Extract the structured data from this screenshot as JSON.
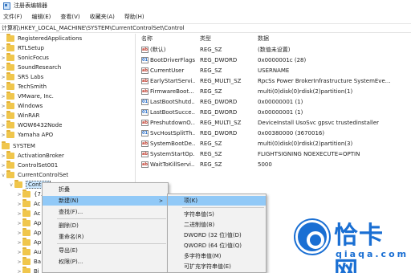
{
  "window": {
    "title": "注册表编辑器"
  },
  "menu": [
    "文件(F)",
    "编辑(E)",
    "查看(V)",
    "收藏夹(A)",
    "帮助(H)"
  ],
  "address": "计算机\\HKEY_LOCAL_MACHINE\\SYSTEM\\CurrentControlSet\\Control",
  "tree": [
    {
      "label": "RegisteredApplications"
    },
    {
      "label": "RTLSetup"
    },
    {
      "label": "SonicFocus"
    },
    {
      "label": "SoundResearch"
    },
    {
      "label": "SRS Labs"
    },
    {
      "label": "TechSmith"
    },
    {
      "label": "VMware, Inc."
    },
    {
      "label": "Windows"
    },
    {
      "label": "WinRAR"
    },
    {
      "label": "WOW6432Node"
    },
    {
      "label": "Yamaha APO"
    },
    {
      "label": "SYSTEM"
    },
    {
      "label": "ActivationBroker"
    },
    {
      "label": "ControlSet001"
    },
    {
      "label": "CurrentControlSet"
    },
    {
      "label": "Control"
    },
    {
      "label": "{7..."
    },
    {
      "label": "Ac"
    },
    {
      "label": "Ac"
    },
    {
      "label": "Ap"
    },
    {
      "label": "Ap"
    },
    {
      "label": "Ap"
    },
    {
      "label": "Au"
    },
    {
      "label": "Ba"
    },
    {
      "label": "Bi"
    }
  ],
  "columns": {
    "name": "名称",
    "type": "类型",
    "data": "数据"
  },
  "values": [
    {
      "name": "(默认)",
      "type": "REG_SZ",
      "data": "(数值未设置)"
    },
    {
      "name": "BootDriverFlags",
      "type": "REG_DWORD",
      "data": "0x0000001c (28)"
    },
    {
      "name": "CurrentUser",
      "type": "REG_SZ",
      "data": "USERNAME"
    },
    {
      "name": "EarlyStartServi...",
      "type": "REG_MULTI_SZ",
      "data": "RpcSs Power BrokerInfrastructure SystemEve..."
    },
    {
      "name": "FirmwareBoot...",
      "type": "REG_SZ",
      "data": "multi(0)disk(0)rdisk(2)partition(1)"
    },
    {
      "name": "LastBootShutd...",
      "type": "REG_DWORD",
      "data": "0x00000001 (1)"
    },
    {
      "name": "LastBootSucce...",
      "type": "REG_DWORD",
      "data": "0x00000001 (1)"
    },
    {
      "name": "PreshutdownO...",
      "type": "REG_MULTI_SZ",
      "data": "DeviceInstall UsoSvc gpsvc trustedinstaller"
    },
    {
      "name": "SvcHostSplitTh...",
      "type": "REG_DWORD",
      "data": "0x00380000 (3670016)"
    },
    {
      "name": "SystemBootDe...",
      "type": "REG_SZ",
      "data": "multi(0)disk(0)rdisk(2)partition(3)"
    },
    {
      "name": "SystemStartOp...",
      "type": "REG_SZ",
      "data": " FLIGHTSIGNING  NOEXECUTE=OPTIN"
    },
    {
      "name": "WaitToKillServi...",
      "type": "REG_SZ",
      "data": "5000"
    }
  ],
  "context_menu": [
    "折叠",
    "新建(N)",
    "查找(F)...",
    "删除(D)",
    "重命名(R)",
    "导出(E)",
    "权限(P)..."
  ],
  "submenu": [
    "项(K)",
    "字符串值(S)",
    "二进制值(B)",
    "DWORD (32 位)值(D)",
    "QWORD (64 位)值(Q)",
    "多字符串值(M)",
    "可扩充字符串值(E)"
  ],
  "watermark": {
    "text": "恰卡网",
    "url": "qiaqa.com"
  }
}
